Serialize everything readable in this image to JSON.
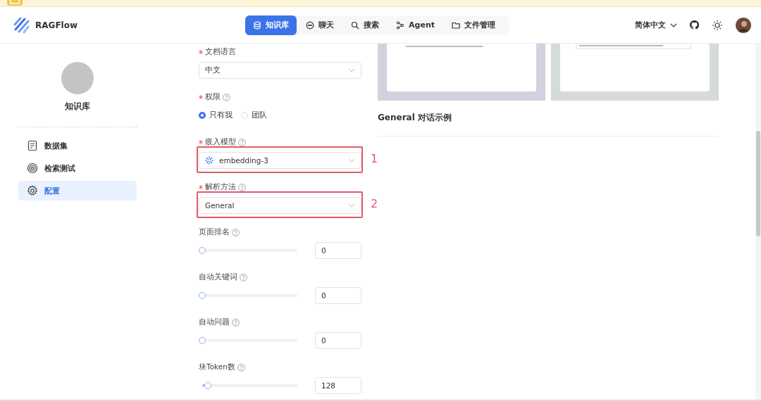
{
  "app": {
    "name": "RAGFlow"
  },
  "nav": [
    {
      "label": "知识库",
      "selected": true
    },
    {
      "label": "聊天",
      "selected": false
    },
    {
      "label": "搜索",
      "selected": false
    },
    {
      "label": "Agent",
      "selected": false
    },
    {
      "label": "文件管理",
      "selected": false
    }
  ],
  "language": {
    "label": "简体中文"
  },
  "sidebar": {
    "title": "知识库",
    "items": [
      {
        "label": "数据集",
        "selected": false
      },
      {
        "label": "检索测试",
        "selected": false
      },
      {
        "label": "配置",
        "selected": true
      }
    ]
  },
  "form": {
    "fields": [
      {
        "kind": "select",
        "label": "文档语言",
        "required": true,
        "help": false,
        "value": "中文",
        "has_icon": false
      },
      {
        "kind": "radio",
        "label": "权限",
        "required": true,
        "help": true,
        "options": [
          {
            "label": "只有我",
            "selected": true
          },
          {
            "label": "团队",
            "selected": false
          }
        ]
      },
      {
        "kind": "select",
        "label": "嵌入模型",
        "required": true,
        "help": true,
        "value": "embedding-3",
        "has_icon": true,
        "annotation": "1"
      },
      {
        "kind": "select",
        "label": "解析方法",
        "required": true,
        "help": true,
        "value": "General",
        "has_icon": false,
        "annotation": "2"
      },
      {
        "kind": "slider",
        "label": "页面排名",
        "required": false,
        "help": true,
        "level": 0,
        "value": "0"
      },
      {
        "kind": "slider",
        "label": "自动关键词",
        "required": false,
        "help": true,
        "level": 0,
        "value": "0"
      },
      {
        "kind": "slider",
        "label": "自动问题",
        "required": false,
        "help": true,
        "level": 0,
        "value": "0"
      },
      {
        "kind": "slider",
        "label": "块Token数",
        "required": false,
        "help": true,
        "level": 0.06,
        "value": "128"
      }
    ]
  },
  "preview": {
    "heading": "General 对话示例"
  }
}
